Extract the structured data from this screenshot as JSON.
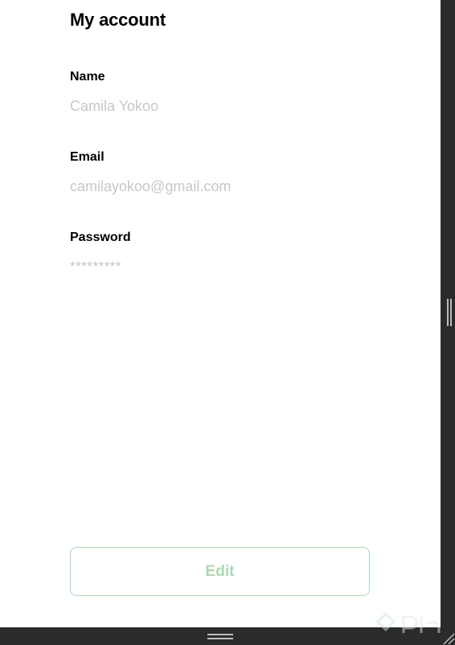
{
  "account": {
    "title": "My account",
    "fields": [
      {
        "label": "Name",
        "value": "Camila Yokoo"
      },
      {
        "label": "Email",
        "value": "camilayokoo@gmail.com"
      },
      {
        "label": "Password",
        "value": "*********"
      }
    ],
    "edit_label": "Edit"
  },
  "colors": {
    "accent": "#acd7b3",
    "value_text": "#c7c7c7",
    "frame": "#2b2b2d"
  },
  "icons": {
    "watermark": "platzi-logo-icon",
    "resize_right": "resize-handle-vertical-icon",
    "resize_bottom": "resize-handle-horizontal-icon",
    "corner": "resize-corner-icon"
  }
}
